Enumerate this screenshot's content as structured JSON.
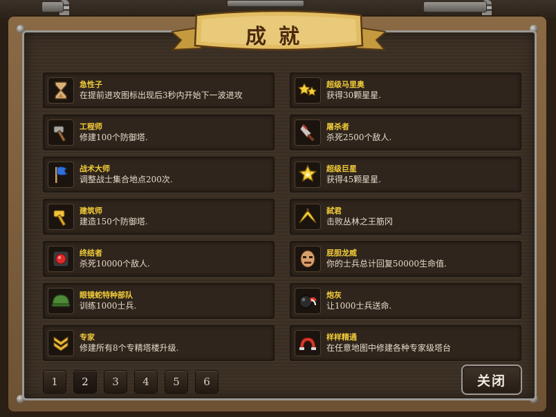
{
  "title": "成就",
  "achievements": [
    {
      "name": "急性子",
      "desc": "在提前进攻图标出现后3秒内开始下一波进攻",
      "icon": "hourglass-icon"
    },
    {
      "name": "超级马里奥",
      "desc": "获得30颗星星.",
      "icon": "stars-icon"
    },
    {
      "name": "工程师",
      "desc": "修建100个防御塔.",
      "icon": "hammer-icon"
    },
    {
      "name": "屠杀者",
      "desc": "杀死2500个敌人.",
      "icon": "cleaver-icon"
    },
    {
      "name": "战术大师",
      "desc": "调整战士集合地点200次.",
      "icon": "flag-icon"
    },
    {
      "name": "超级巨星",
      "desc": "获得45颗星星.",
      "icon": "big-star-icon"
    },
    {
      "name": "建筑师",
      "desc": "建造150个防御塔.",
      "icon": "gold-hammer-icon"
    },
    {
      "name": "弑君",
      "desc": "击败丛林之王筋冈",
      "icon": "banana-icon"
    },
    {
      "name": "终结者",
      "desc": "杀死10000个敌人.",
      "icon": "red-button-icon"
    },
    {
      "name": "屁胆龙威",
      "desc": "你的士兵总计回复50000生命值.",
      "icon": "face-icon"
    },
    {
      "name": "眼镜蛇特种部队",
      "desc": "训练1000士兵.",
      "icon": "helmet-icon"
    },
    {
      "name": "炮灰",
      "desc": "让1000士兵送命.",
      "icon": "cannonball-icon"
    },
    {
      "name": "专家",
      "desc": "修建所有8个专精塔楼升级.",
      "icon": "chevron-rank-icon"
    },
    {
      "name": "样样精通",
      "desc": "在任意地图中修建各种专家级塔台",
      "icon": "magnet-icon"
    }
  ],
  "pages": [
    "1",
    "2",
    "3",
    "4",
    "5",
    "6"
  ],
  "current_page": "2",
  "close_label": "关闭"
}
